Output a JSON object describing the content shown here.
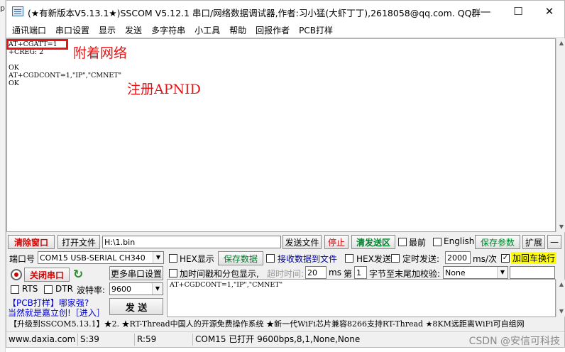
{
  "window": {
    "title": "(★有新版本V5.13.1★)SSCOM V5.12.1 串口/网络数据调试器,作者:习小猛(大虾丁丁),2618058@qq.com. QQ群",
    "minimize": "—",
    "maximize": "☐",
    "close": "✕"
  },
  "menu": [
    "通讯端口",
    "串口设置",
    "显示",
    "发送",
    "多字符串",
    "小工具",
    "帮助",
    "回报作者",
    "PCB打样"
  ],
  "terminal": {
    "lines": [
      "AT+CGATT=1",
      "+CREG: 2",
      "",
      "OK",
      "AT+CGDCONT=1,\"IP\",\"CMNET\"",
      "OK"
    ]
  },
  "annotations": {
    "attach": "附着网络",
    "apn": "注册APNID"
  },
  "toolbar": {
    "clear": "清除窗口",
    "open_file": "打开文件",
    "file_path": "H:\\1.bin",
    "send_file": "发送文件",
    "stop": "停止",
    "clear_send": "清发送区",
    "topmost": "最前",
    "english": "English",
    "save_params": "保存参数",
    "expand": "扩展",
    "collapse": "—"
  },
  "port": {
    "label": "端口号",
    "value": "COM15 USB-SERIAL CH340",
    "close_port": "关闭串口",
    "more_settings": "更多串口设置",
    "rts": "RTS",
    "dtr": "DTR",
    "baud_label": "波特率:",
    "baud": "9600"
  },
  "options": {
    "hex_display": "HEX显示",
    "save_data": "保存数据",
    "recv_to_file": "接收数据到文件",
    "hex_send": "HEX发送",
    "timed_send": "定时发送:",
    "interval": "2000",
    "interval_unit": "ms/次",
    "add_crlf": "加回车换行",
    "timestamp": "加时间戳和分包显示,",
    "timeout_label": "超时时间:",
    "timeout": "20",
    "timeout_unit": "ms",
    "page_prefix": "第",
    "page_num": "1",
    "checksum_label": "字节至末尾加校验:",
    "checksum": "None"
  },
  "send": {
    "text": "AT+CGDCONT=1,\"IP\",\"CMNET\"",
    "button": "发  送"
  },
  "promo": {
    "line1": "【PCB打样】哪家强?",
    "line2": "当然就是嘉立创!［进入］"
  },
  "marquee": "【升级到SSCOM5.13.1】★2. ★RT-Thread中国人的开源免费操作系统 ★新一代WiFi芯片兼容8266支持RT-Thread ★8KM远距离WiFi可自组网",
  "status": {
    "site": "www.daxia.com",
    "sent": "S:39",
    "recv": "R:59",
    "port_state": "COM15 已打开  9600bps,8,1,None,None"
  },
  "watermark": "CSDN @安信可科技",
  "icons": {
    "port_indicator": "record-icon",
    "refresh": "refresh-icon"
  },
  "colors": {
    "red_text": "#d40000",
    "green_text": "#00802b",
    "annotation_red": "#e81010",
    "crlf_highlight": "#ffff00"
  }
}
